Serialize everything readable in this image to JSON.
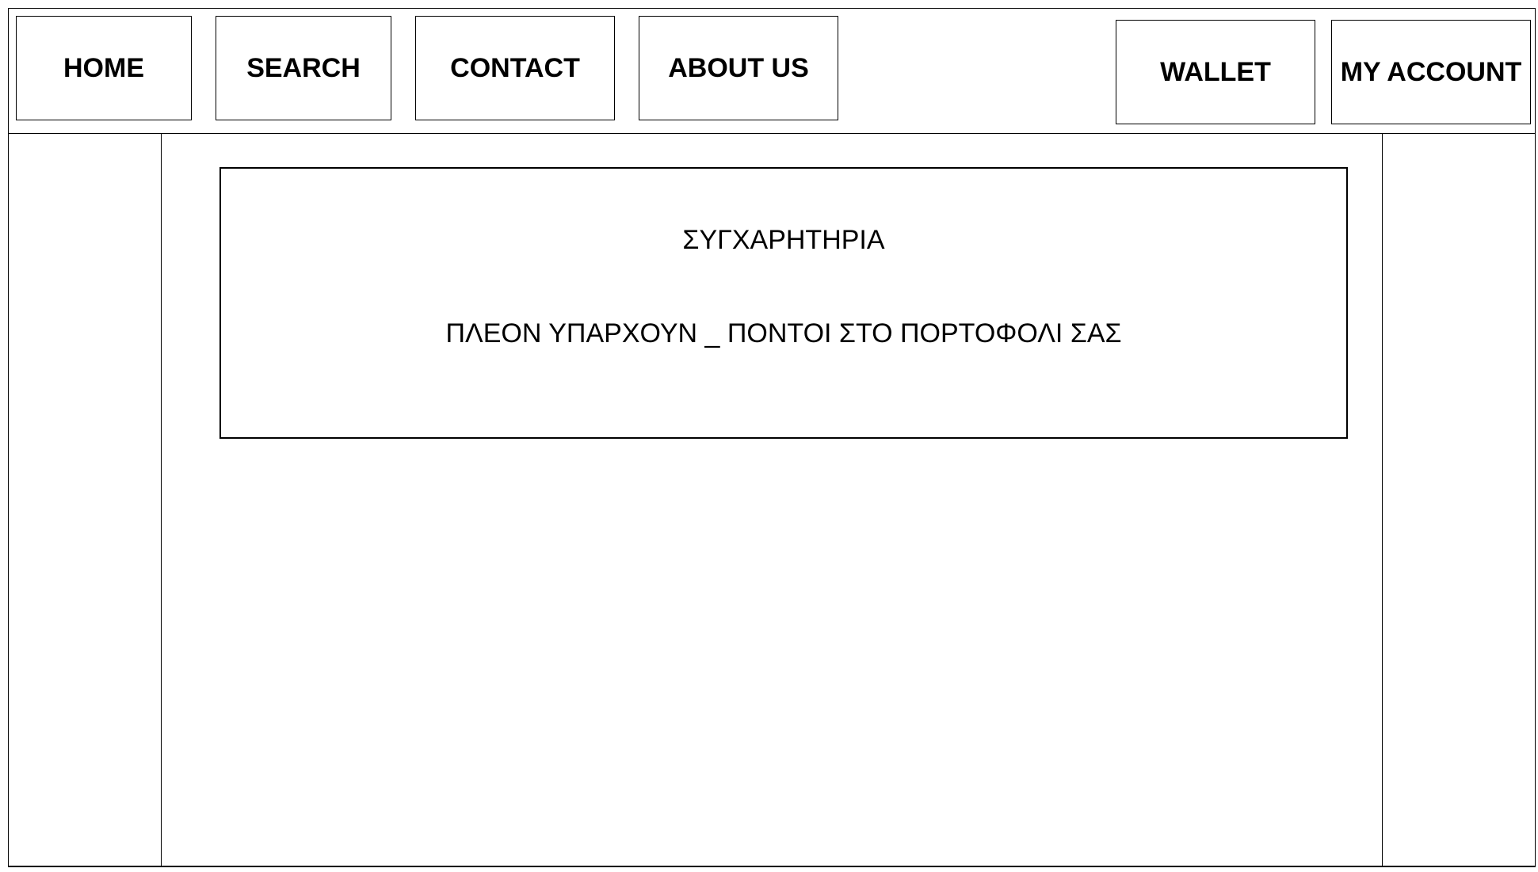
{
  "nav": {
    "home": "HOME",
    "search": "SEARCH",
    "contact": "CONTACT",
    "about_us": "ABOUT US",
    "wallet": "WALLET",
    "my_account": "MY ACCOUNT"
  },
  "message": {
    "title": "ΣΥΓΧΑΡΗΤΗΡΙΑ",
    "body": "ΠΛΕΟΝ ΥΠΑΡΧΟΥΝ _ ΠΟΝΤΟΙ ΣΤΟ ΠΟΡΤΟΦΟΛΙ ΣΑΣ"
  }
}
